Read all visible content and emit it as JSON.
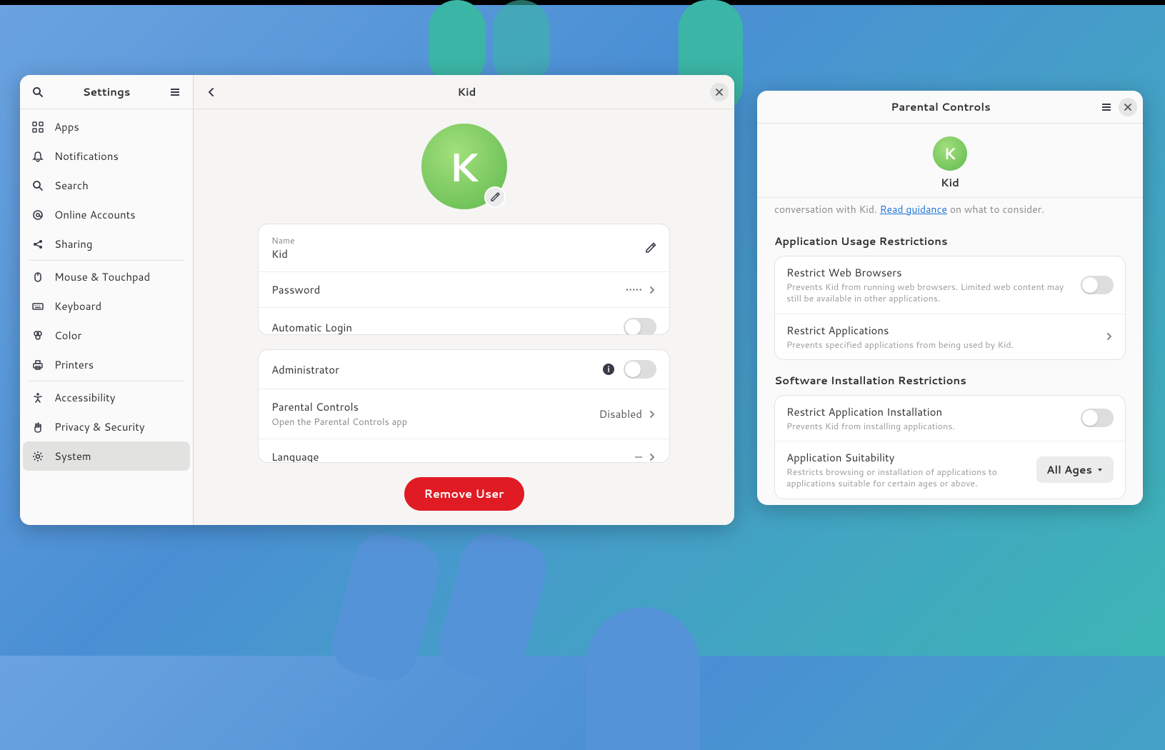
{
  "settings": {
    "app_title": "Settings",
    "sidebar": {
      "items": [
        {
          "label": "Apps"
        },
        {
          "label": "Notifications"
        },
        {
          "label": "Search"
        },
        {
          "label": "Online Accounts"
        },
        {
          "label": "Sharing"
        },
        {
          "label": "Mouse & Touchpad"
        },
        {
          "label": "Keyboard"
        },
        {
          "label": "Color"
        },
        {
          "label": "Printers"
        },
        {
          "label": "Accessibility"
        },
        {
          "label": "Privacy & Security"
        },
        {
          "label": "System"
        }
      ],
      "active_index": 11
    },
    "detail": {
      "header_title": "Kid",
      "avatar_letter": "K",
      "rows": {
        "name_label": "Name",
        "name_value": "Kid",
        "password_label": "Password",
        "password_value": "•••••",
        "auto_login_label": "Automatic Login",
        "auto_login_on": false,
        "admin_label": "Administrator",
        "admin_on": false,
        "parental_label": "Parental Controls",
        "parental_sub": "Open the Parental Controls app",
        "parental_value": "Disabled",
        "language_label": "Language",
        "language_value": "—"
      },
      "remove_button": "Remove User"
    }
  },
  "parental": {
    "title": "Parental Controls",
    "user_letter": "K",
    "user_name": "Kid",
    "truncated_prefix": "conversation with Kid. ",
    "truncated_link": "Read guidance",
    "truncated_suffix": " on what to consider.",
    "section_usage": "Application Usage Restrictions",
    "section_install": "Software Installation Restrictions",
    "rows": {
      "restrict_browsers_title": "Restrict Web Browsers",
      "restrict_browsers_desc": "Prevents Kid from running web browsers. Limited web content may still be available in other applications.",
      "restrict_browsers_on": false,
      "restrict_apps_title": "Restrict Applications",
      "restrict_apps_desc": "Prevents specified applications from being used by Kid.",
      "restrict_install_title": "Restrict Application Installation",
      "restrict_install_desc": "Prevents Kid from installing applications.",
      "restrict_install_on": false,
      "suitability_title": "Application Suitability",
      "suitability_desc": "Restricts browsing or installation of applications to applications suitable for certain ages or above.",
      "suitability_value": "All Ages"
    }
  }
}
